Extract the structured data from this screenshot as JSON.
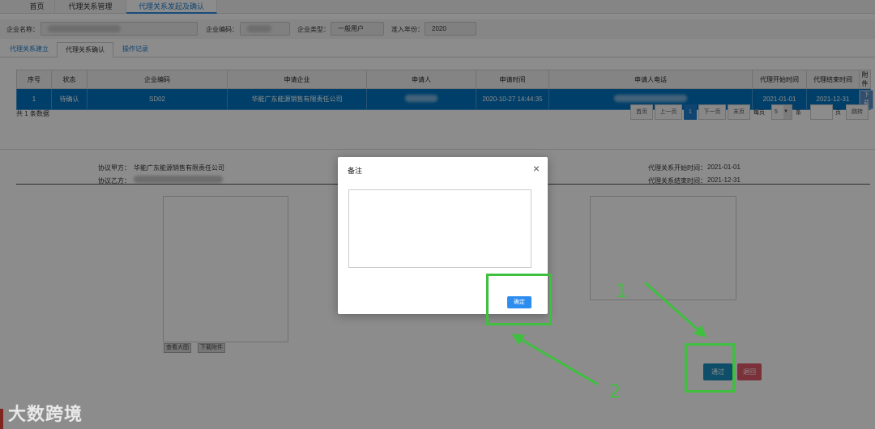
{
  "top_tabs": [
    "首页",
    "代理关系管理",
    "代理关系发起及确认"
  ],
  "filters": {
    "company_name_label": "企业名称：",
    "company_code_label": "企业编码：",
    "company_type_label": "企业类型：",
    "company_type_value": "一般用户",
    "access_year_label": "准入年份：",
    "access_year_value": "2020"
  },
  "sub_tabs": [
    "代理关系建立",
    "代理关系确认",
    "操作记录"
  ],
  "table": {
    "headers": [
      "序号",
      "状态",
      "企业编码",
      "申请企业",
      "申请人",
      "申请时间",
      "申请人电话",
      "代理开始时间",
      "代理结束时间",
      "附件"
    ],
    "row": {
      "index": "1",
      "status": "待确认",
      "code": "SD02",
      "company": "华能广东能源销售有限责任公司",
      "time": "2020-10-27 14:44:35",
      "start": "2021-01-01",
      "end": "2021-12-31",
      "download": "下载"
    }
  },
  "total_text": "共 1 条数据",
  "pager": {
    "first": "首页",
    "prev": "上一页",
    "current": "1",
    "next": "下一页",
    "last": "末页",
    "per_page_label": "每页",
    "per_page_value": "5",
    "unit": "条",
    "page_label": "页",
    "jump": "跳转"
  },
  "detail": {
    "party_a_label": "协议甲方：",
    "party_a_value": "华能广东能源销售有限责任公司",
    "party_b_label": "协议乙方：",
    "start_label": "代理关系开始时间：",
    "start_value": "2021-01-01",
    "end_label": "代理关系结束时间：",
    "end_value": "2021-12-31",
    "view_large": "查看大图",
    "download_attachment": "下载附件",
    "approve": "通过",
    "reject": "退回"
  },
  "modal": {
    "title": "备注",
    "close": "×",
    "ok": "确定"
  },
  "annotations": {
    "one": "1",
    "two": "2",
    "color": "#3fbf3f"
  },
  "watermark": "大数跨境",
  "colors": {
    "selected_row": "#0073bf",
    "primary": "#2d8cf0",
    "approve": "#1a8fbe",
    "reject": "#e05a6a"
  }
}
